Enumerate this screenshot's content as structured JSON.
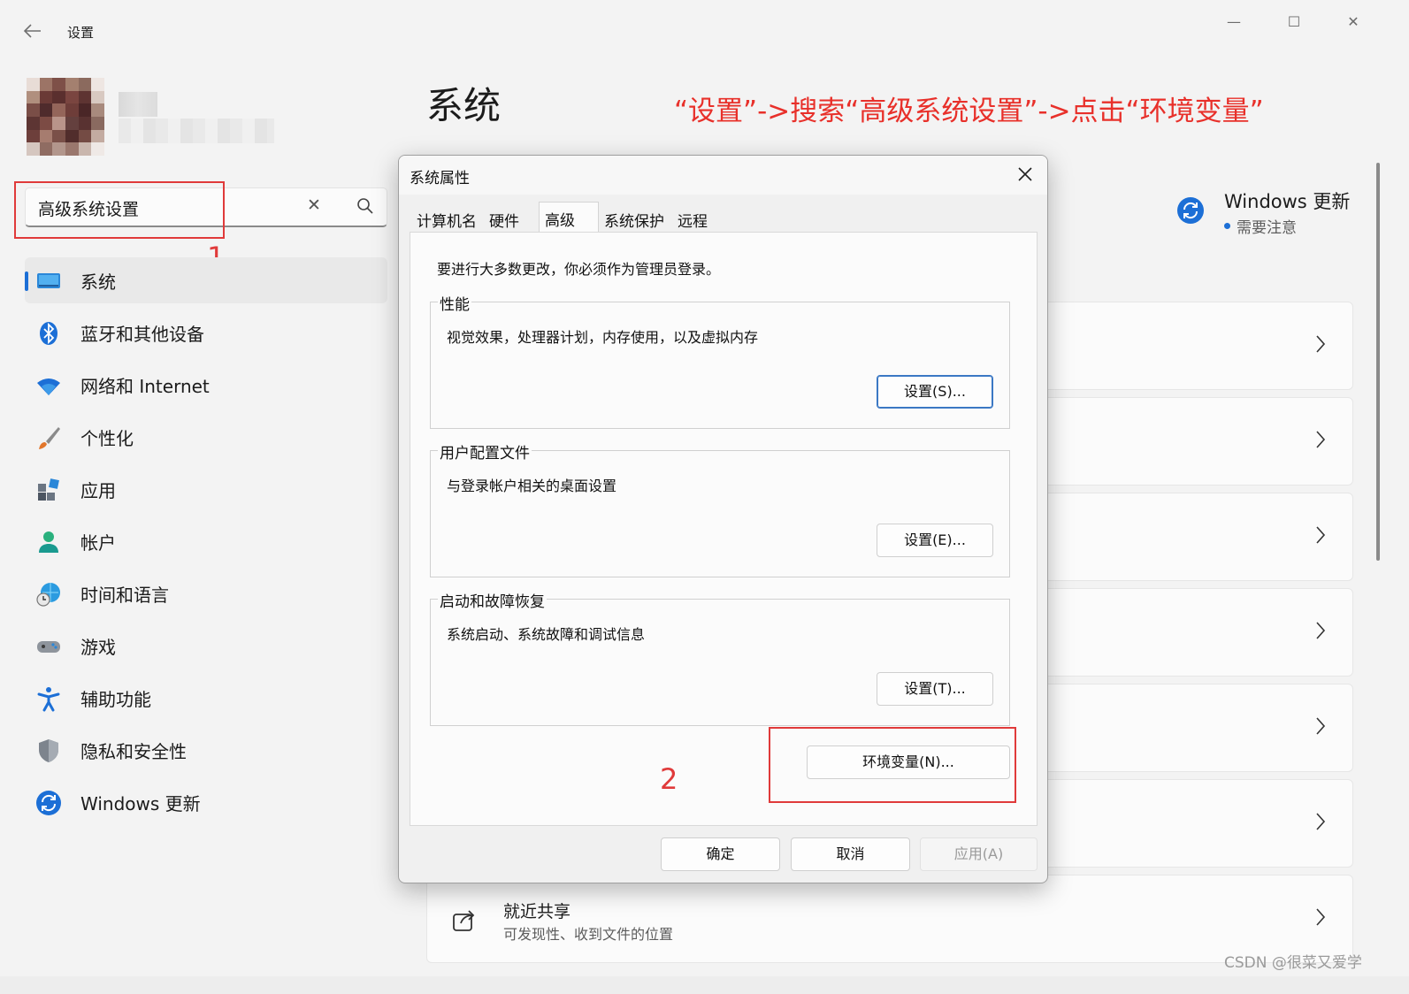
{
  "window": {
    "title": "设置",
    "minimize_glyph": "—",
    "maximize_glyph": "☐",
    "close_glyph": "✕"
  },
  "search": {
    "value": "高级系统设置",
    "clear_glyph": "✕"
  },
  "annotations": {
    "step1": "1",
    "step2": "2",
    "caption": "“设置”->搜索“高级系统设置”->点击“环境变量”"
  },
  "sidebar": {
    "items": [
      {
        "label": "系统",
        "icon": "monitor-icon",
        "active": true
      },
      {
        "label": "蓝牙和其他设备",
        "icon": "bluetooth-icon"
      },
      {
        "label": "网络和 Internet",
        "icon": "wifi-icon"
      },
      {
        "label": "个性化",
        "icon": "brush-icon"
      },
      {
        "label": "应用",
        "icon": "apps-icon"
      },
      {
        "label": "帐户",
        "icon": "person-icon"
      },
      {
        "label": "时间和语言",
        "icon": "globe-clock-icon"
      },
      {
        "label": "游戏",
        "icon": "gamepad-icon"
      },
      {
        "label": "辅助功能",
        "icon": "accessibility-icon"
      },
      {
        "label": "隐私和安全性",
        "icon": "shield-icon"
      },
      {
        "label": "Windows 更新",
        "icon": "update-icon"
      }
    ]
  },
  "main": {
    "title": "系统",
    "update": {
      "title": "Windows 更新",
      "status": "需要注意"
    },
    "nearby_share": {
      "title": "就近共享",
      "subtitle": "可发现性、收到文件的位置"
    }
  },
  "dialog": {
    "title": "系统属性",
    "tabs": [
      "计算机名",
      "硬件",
      "高级",
      "系统保护",
      "远程"
    ],
    "active_tab": "高级",
    "admin_note": "要进行大多数更改，你必须作为管理员登录。",
    "performance": {
      "legend": "性能",
      "desc": "视觉效果，处理器计划，内存使用，以及虚拟内存",
      "button": "设置(S)..."
    },
    "user_profiles": {
      "legend": "用户配置文件",
      "desc": "与登录帐户相关的桌面设置",
      "button": "设置(E)..."
    },
    "startup_recovery": {
      "legend": "启动和故障恢复",
      "desc": "系统启动、系统故障和调试信息",
      "button": "设置(T)..."
    },
    "env_button": "环境变量(N)...",
    "ok": "确定",
    "cancel": "取消",
    "apply": "应用(A)"
  },
  "watermark": "CSDN @很菜又爱学",
  "colors": {
    "accent": "#1c6fd6",
    "annotation_red": "#e03a3a",
    "caption_red": "#e8302a"
  }
}
